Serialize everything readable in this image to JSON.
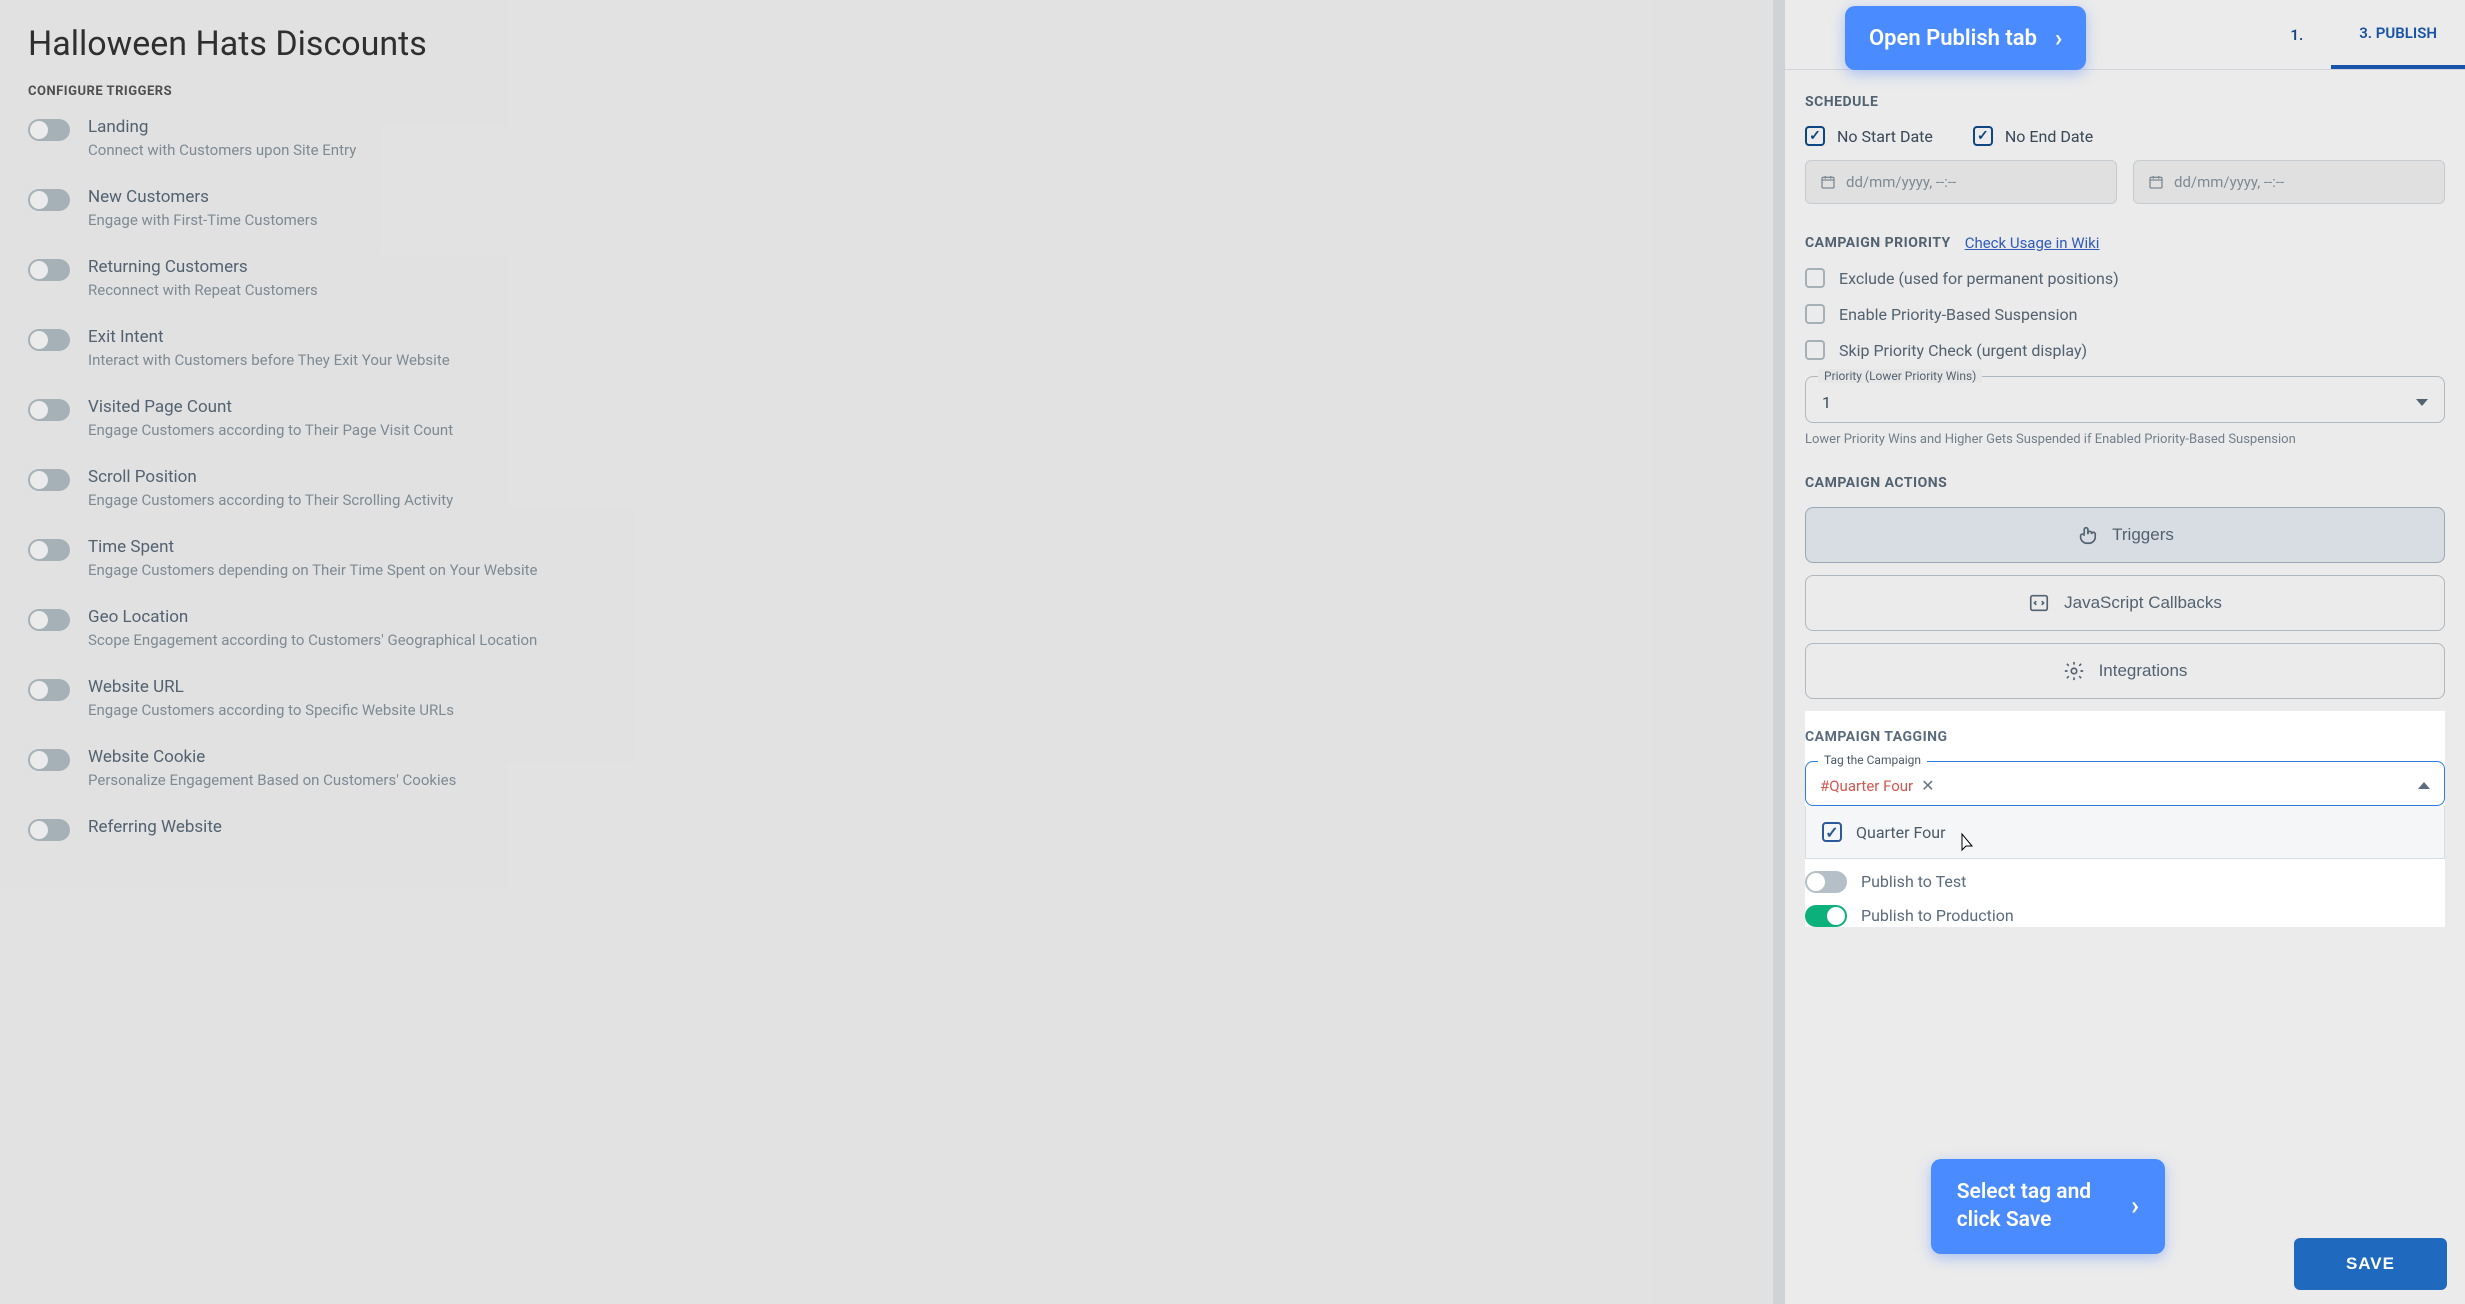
{
  "page_title": "Halloween Hats Discounts",
  "triggers_header": "CONFIGURE TRIGGERS",
  "triggers": [
    {
      "title": "Landing",
      "desc": "Connect with Customers upon Site Entry"
    },
    {
      "title": "New Customers",
      "desc": "Engage with First-Time Customers"
    },
    {
      "title": "Returning Customers",
      "desc": "Reconnect with Repeat Customers"
    },
    {
      "title": "Exit Intent",
      "desc": "Interact with Customers before They Exit Your Website"
    },
    {
      "title": "Visited Page Count",
      "desc": "Engage Customers according to Their Page Visit Count"
    },
    {
      "title": "Scroll Position",
      "desc": "Engage Customers according to Their Scrolling Activity"
    },
    {
      "title": "Time Spent",
      "desc": "Engage Customers depending on Their Time Spent on Your Website"
    },
    {
      "title": "Geo Location",
      "desc": "Scope Engagement according to Customers' Geographical Location"
    },
    {
      "title": "Website URL",
      "desc": "Engage Customers according to Specific Website URLs"
    },
    {
      "title": "Website Cookie",
      "desc": "Personalize Engagement Based on Customers' Cookies"
    },
    {
      "title": "Referring Website",
      "desc": ""
    }
  ],
  "tabs": {
    "step1_prefix": "1.",
    "step3": "3. PUBLISH"
  },
  "tooltip_publish": "Open Publish tab",
  "tooltip_save": "Select tag and click Save",
  "schedule": {
    "header": "SCHEDULE",
    "no_start": "No Start Date",
    "no_end": "No End Date",
    "placeholder": "dd/mm/yyyy, --:--"
  },
  "priority": {
    "header": "CAMPAIGN PRIORITY",
    "wiki": "Check Usage in Wiki",
    "exclude": "Exclude (used for permanent positions)",
    "enable_susp": "Enable Priority-Based Suspension",
    "skip": "Skip Priority Check (urgent display)",
    "select_label": "Priority (Lower Priority Wins)",
    "value": "1",
    "helper": "Lower Priority Wins and Higher Gets Suspended if Enabled Priority-Based Suspension"
  },
  "actions": {
    "header": "CAMPAIGN ACTIONS",
    "triggers": "Triggers",
    "callbacks": "JavaScript Callbacks",
    "integrations": "Integrations"
  },
  "tagging": {
    "header": "CAMPAIGN TAGGING",
    "field_label": "Tag the Campaign",
    "chip": "#Quarter Four",
    "option": "Quarter Four"
  },
  "publish": {
    "test": "Publish to Test",
    "prod": "Publish to Production"
  },
  "save_label": "SAVE"
}
